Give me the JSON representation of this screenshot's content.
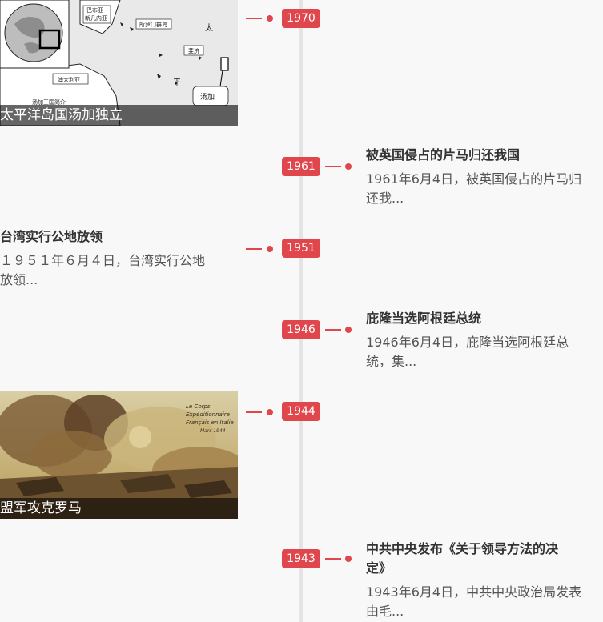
{
  "timeline": {
    "events": [
      {
        "year": "1970",
        "caption": "太平洋岛国汤加独立"
      },
      {
        "year": "1961",
        "title": "被英国侵占的片马归还我国",
        "desc_lines": [
          "1961年6月4日，被英国侵占的片马归",
          "还我..."
        ]
      },
      {
        "year": "1951",
        "title": "台湾实行公地放领",
        "desc_lines": [
          "１９５１年６月４日，台湾实行公地",
          "放领..."
        ]
      },
      {
        "year": "1946",
        "title": "庇隆当选阿根廷总统",
        "desc_lines": [
          "1946年6月4日，庇隆当选阿根廷总",
          "统，集..."
        ]
      },
      {
        "year": "1944",
        "caption": "盟军攻克罗马"
      },
      {
        "year": "1943",
        "title_lines": [
          "中共中央发布《关于领导方法的决",
          "定》"
        ],
        "desc_lines": [
          "1943年6月4日，中共中央政治局发表",
          "由毛..."
        ]
      }
    ]
  },
  "map": {
    "labels": [
      "巴布亚",
      "新几内亚",
      "所罗门群岛",
      "太",
      "斐济",
      "平",
      "汤加",
      "澳大利亚",
      "汤加王国简介"
    ]
  },
  "painting": {
    "text_lines": [
      "Le Corps",
      "Expéditionnaire",
      "Français en Italie",
      "Mars 1944"
    ]
  },
  "colors": {
    "accent": "#e0474c",
    "axis": "#e4e4e4",
    "background": "#f8f8f8"
  }
}
